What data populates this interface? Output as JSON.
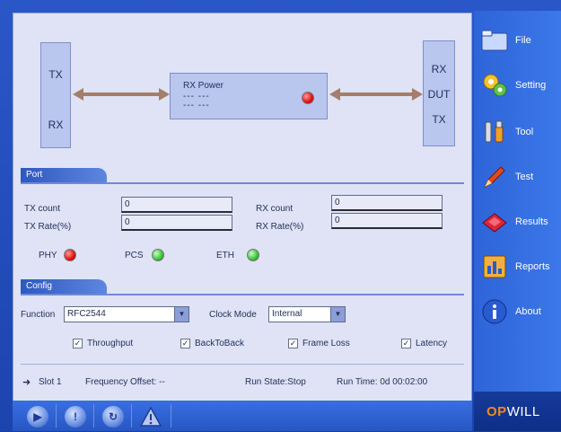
{
  "diagram": {
    "tx_box": {
      "top": "TX",
      "bottom": "RX"
    },
    "rx_power": {
      "label": "RX Power",
      "value_line1": "--- ---",
      "value_line2": "--- ---"
    },
    "dut_box": {
      "top": "RX",
      "middle": "DUT",
      "bottom": "TX"
    }
  },
  "port": {
    "title": "Port",
    "tx_count_label": "TX count",
    "tx_count_value": "0",
    "tx_rate_label": "TX Rate(%)",
    "tx_rate_value": "0",
    "rx_count_label": "RX count",
    "rx_count_value": "0",
    "rx_rate_label": "RX Rate(%)",
    "rx_rate_value": "0",
    "indicators": [
      {
        "label": "PHY",
        "state": "red"
      },
      {
        "label": "PCS",
        "state": "green"
      },
      {
        "label": "ETH",
        "state": "green"
      }
    ]
  },
  "config": {
    "title": "Config",
    "function_label": "Function",
    "function_value": "RFC2544",
    "clock_label": "Clock Mode",
    "clock_value": "Internal",
    "checks": [
      {
        "label": "Throughput",
        "checked": true
      },
      {
        "label": "BackToBack",
        "checked": true
      },
      {
        "label": "Frame Loss",
        "checked": true
      },
      {
        "label": "Latency",
        "checked": true
      }
    ]
  },
  "status": {
    "slot": "Slot 1",
    "freq_offset": "Frequency Offset: --",
    "run_state": "Run State:Stop",
    "run_time": "Run Time: 0d  00:02:00"
  },
  "sidebar": {
    "items": [
      {
        "label": "File",
        "icon": "folder-icon"
      },
      {
        "label": "Setting",
        "icon": "gears-icon"
      },
      {
        "label": "Tool",
        "icon": "wrench-icon"
      },
      {
        "label": "Test",
        "icon": "pencil-icon"
      },
      {
        "label": "Results",
        "icon": "results-icon"
      },
      {
        "label": "Reports",
        "icon": "report-icon"
      },
      {
        "label": "About",
        "icon": "info-icon"
      }
    ]
  },
  "logo": {
    "op": "OP",
    "will": "WILL"
  },
  "colors": {
    "accent": "#2e64d8",
    "panel": "#dfe3f5",
    "led_red": "#e01010",
    "led_green": "#39c23a",
    "logo_orange": "#f08a1c"
  }
}
